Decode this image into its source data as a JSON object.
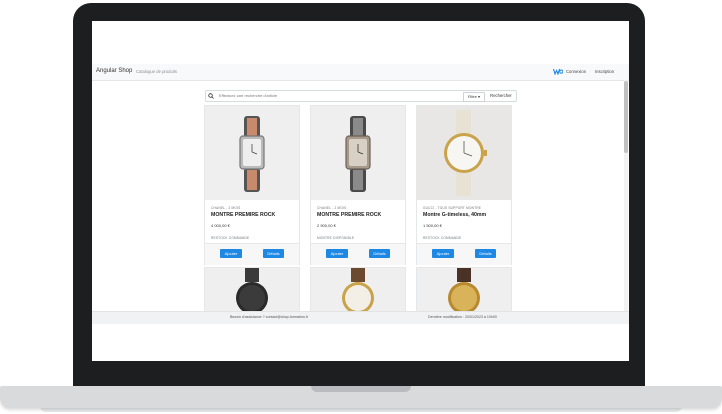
{
  "navbar": {
    "brand": "Angular Shop",
    "catalog_link": "Catalogue de produits",
    "login": "Connexion",
    "register": "Inscription",
    "logo_color": "#1e88e5"
  },
  "search": {
    "placeholder": "Effectuez une recherche d'article",
    "filter_label": "Filtre ▾",
    "search_button": "Rechercher"
  },
  "products": [
    {
      "brand": "CHANEL - 2 MOIS",
      "title": "MONTRE PREMIRE ROCK",
      "price": "4 000,00 €",
      "stock": "RESTOCK COMMANDE",
      "add_label": "Ajouter",
      "details_label": "Détails"
    },
    {
      "brand": "CHANEL - 2 MOIS",
      "title": "MONTRE PREMIRE ROCK",
      "price": "2 900,00 €",
      "stock": "MONTRE DISPONIBLE",
      "add_label": "Ajouter",
      "details_label": "Détails"
    },
    {
      "brand": "GUCCI - TOUS SUPPORT MONTRE",
      "title": "Montre G-timeless, 40mm",
      "price": "1 500,00 €",
      "stock": "RESTOCK COMMANDE",
      "add_label": "Ajouter",
      "details_label": "Détails"
    }
  ],
  "footer": {
    "contact": "Besoin d'assistance ? contact@shop-formation.fr",
    "updated": "Dernière modification : 20/01/2023 à 10h00"
  },
  "icons": {
    "search": "search-icon",
    "logo": "shop-logo-icon"
  }
}
